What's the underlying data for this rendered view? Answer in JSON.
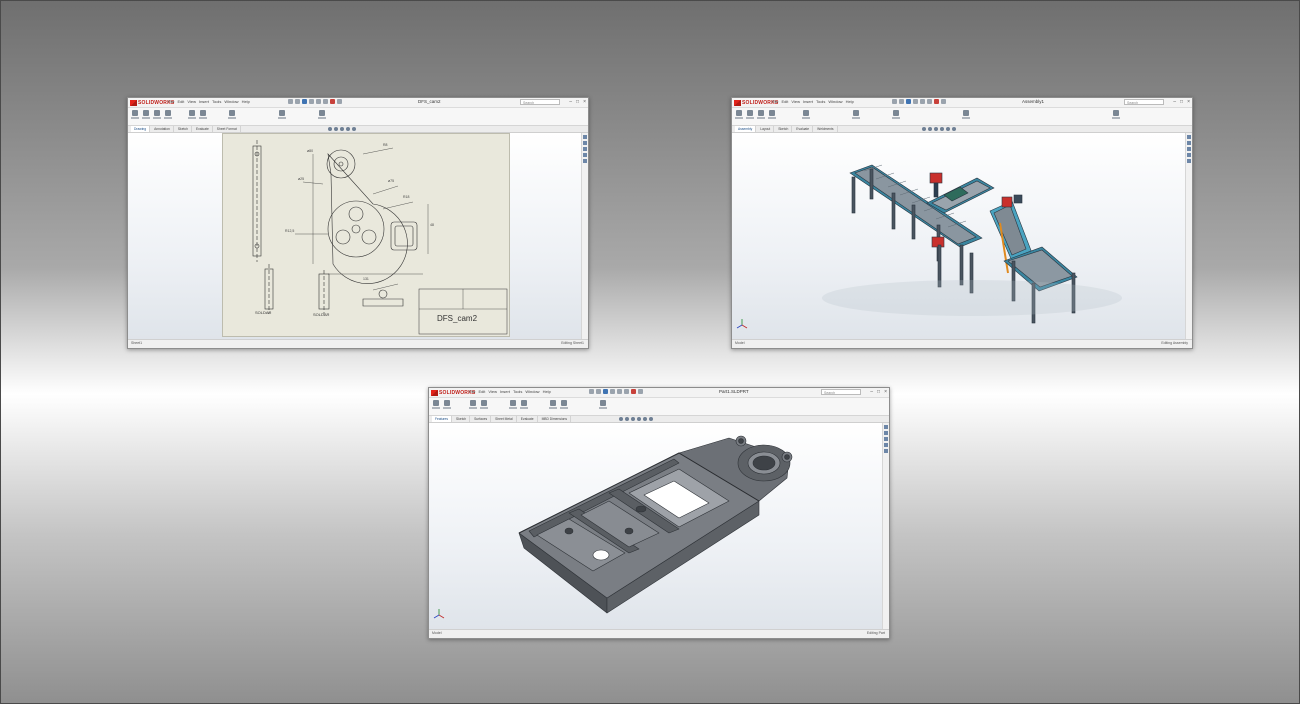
{
  "app": {
    "brand": "SOLIDWORKS"
  },
  "windows": [
    {
      "id": "drawing",
      "menu_items": [
        "File",
        "Edit",
        "View",
        "Insert",
        "Tools",
        "Window",
        "Help"
      ],
      "doc_title": "DFS_cam2",
      "search_placeholder": "Search",
      "tabs": [
        "Drawing",
        "Annotation",
        "Sketch",
        "Evaluate",
        "Sheet Format"
      ],
      "active_tab": 0,
      "sheet_label": "DFS_cam2",
      "view_labels": [
        "SOLDAR",
        "SOLDAR"
      ],
      "status_left": "Sheet1",
      "status_right": "Editing Sheet1"
    },
    {
      "id": "assembly",
      "menu_items": [
        "File",
        "Edit",
        "View",
        "Insert",
        "Tools",
        "Window",
        "Help"
      ],
      "doc_title": "Assembly1",
      "search_placeholder": "Search",
      "tabs": [
        "Assembly",
        "Layout",
        "Sketch",
        "Evaluate",
        "Weldments"
      ],
      "active_tab": 0,
      "status_left": "Model",
      "status_right": "Editing Assembly"
    },
    {
      "id": "part",
      "menu_items": [
        "File",
        "Edit",
        "View",
        "Insert",
        "Tools",
        "Window",
        "Help"
      ],
      "doc_title": "Part1.SLDPRT",
      "search_placeholder": "Search",
      "tabs": [
        "Features",
        "Sketch",
        "Surfaces",
        "Sheet Metal",
        "Evaluate",
        "MBD Dimensions"
      ],
      "active_tab": 0,
      "status_left": "Model",
      "status_right": "Editing Part"
    }
  ]
}
